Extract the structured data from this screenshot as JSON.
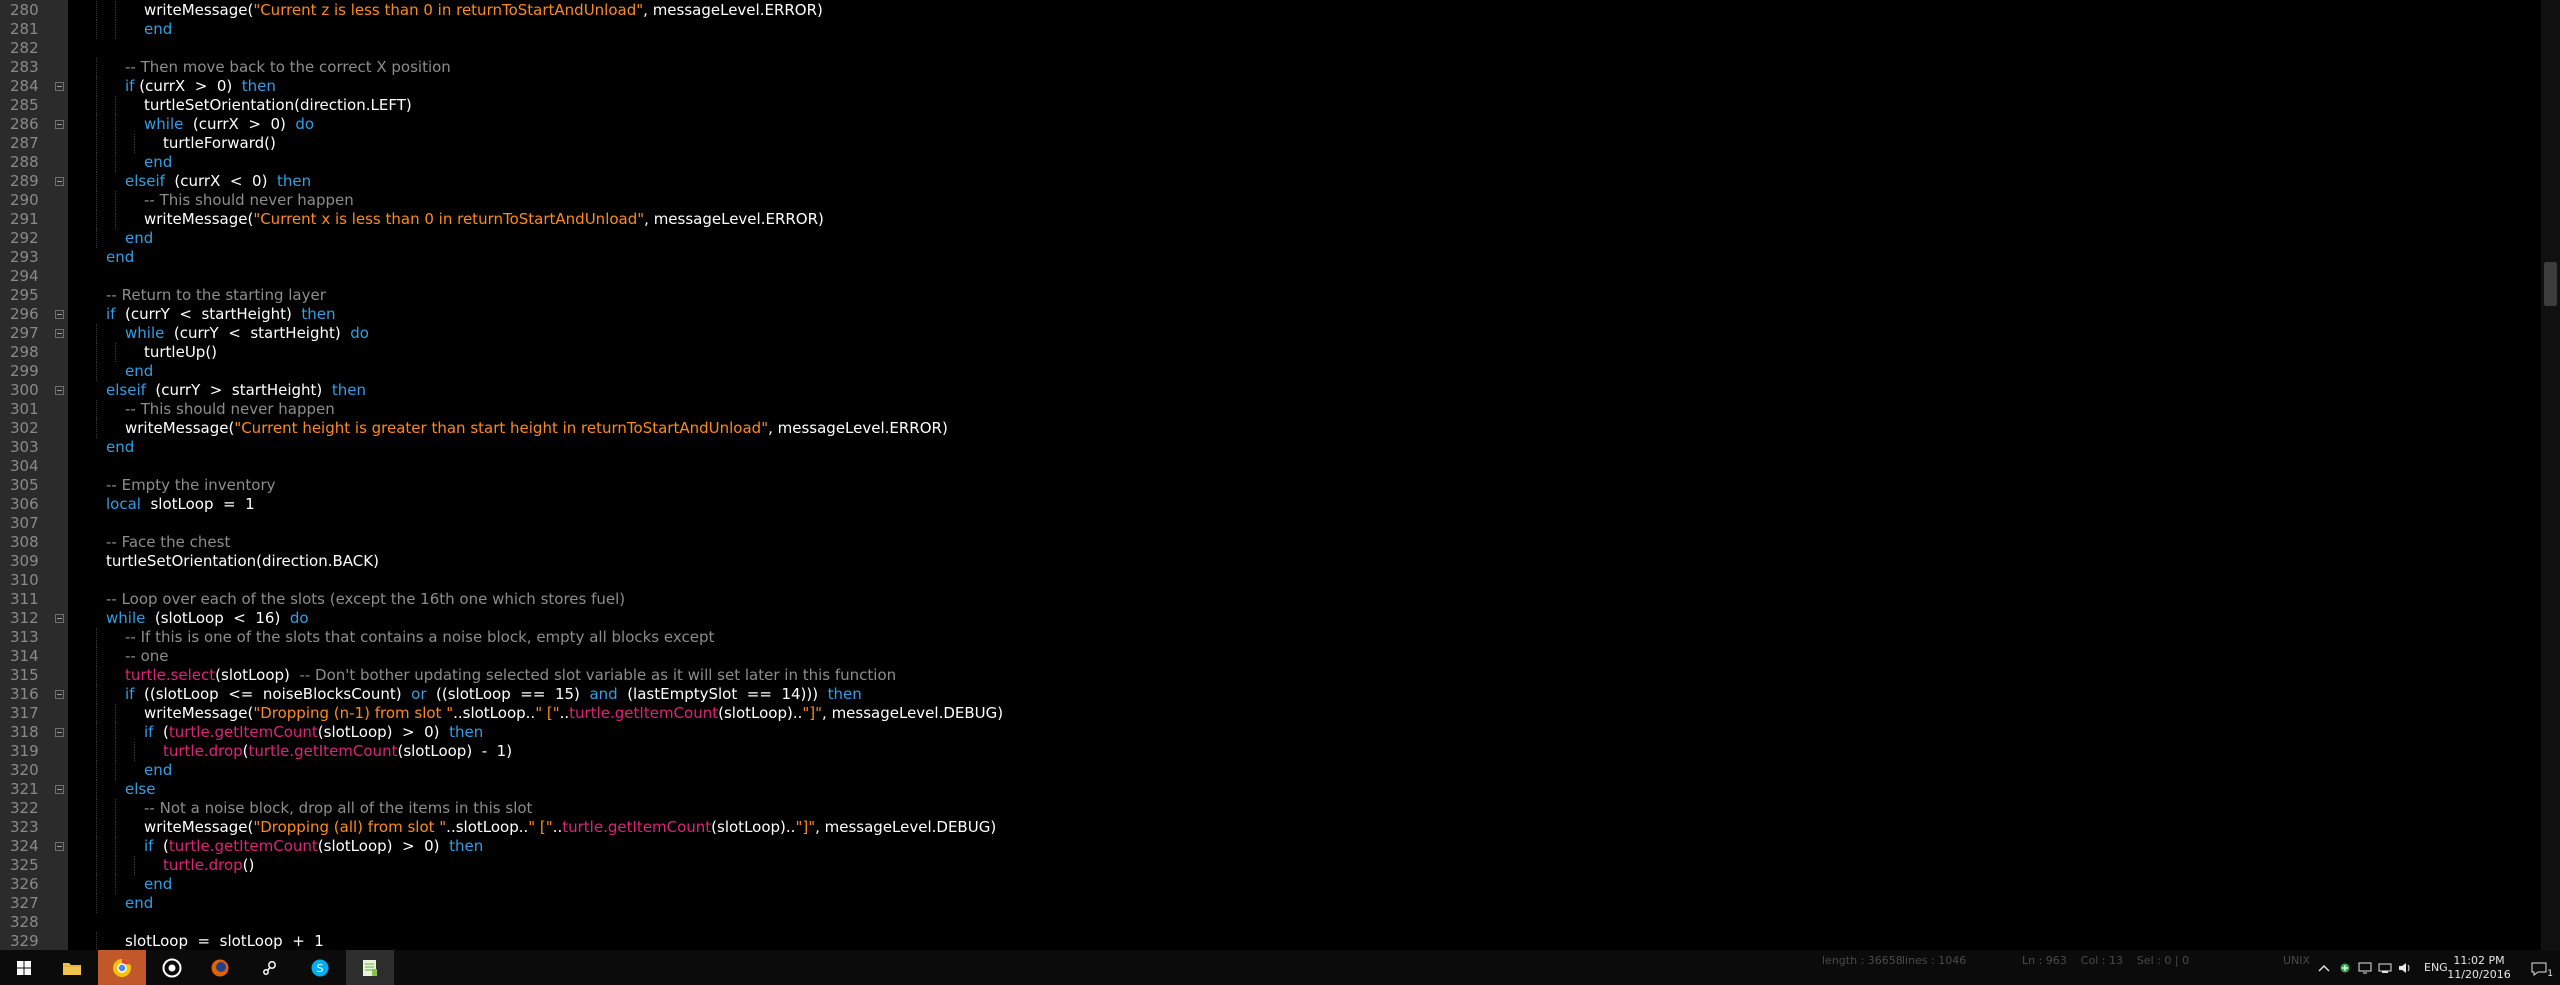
{
  "editor": {
    "lines": [
      {
        "num": 280,
        "indent": 2,
        "tokens": [
          [
            "id",
            "writeMessage("
          ],
          [
            "str",
            "\"Current z is less than 0 in returnToStartAndUnload\""
          ],
          [
            "id",
            ", messageLevel.ERROR)"
          ]
        ]
      },
      {
        "num": 281,
        "indent": 2,
        "tokens": [
          [
            "kw",
            "end"
          ]
        ]
      },
      {
        "num": 282,
        "indent": 0,
        "tokens": []
      },
      {
        "num": 283,
        "indent": 1,
        "tokens": [
          [
            "com",
            "-- Then move back to the correct X position"
          ]
        ]
      },
      {
        "num": 284,
        "indent": 1,
        "fold": true,
        "tokens": [
          [
            "kw",
            "if"
          ],
          [
            "id",
            " (currX  >  0)  "
          ],
          [
            "kw",
            "then"
          ]
        ]
      },
      {
        "num": 285,
        "indent": 2,
        "tokens": [
          [
            "id",
            "turtleSetOrientation(direction.LEFT)"
          ]
        ]
      },
      {
        "num": 286,
        "indent": 2,
        "fold": true,
        "tokens": [
          [
            "kw",
            "while"
          ],
          [
            "id",
            "  (currX  >  0)  "
          ],
          [
            "kw",
            "do"
          ]
        ]
      },
      {
        "num": 287,
        "indent": 3,
        "tokens": [
          [
            "id",
            "turtleForward()"
          ]
        ]
      },
      {
        "num": 288,
        "indent": 2,
        "tokens": [
          [
            "kw",
            "end"
          ]
        ]
      },
      {
        "num": 289,
        "indent": 1,
        "fold": true,
        "tokens": [
          [
            "kw",
            "elseif"
          ],
          [
            "id",
            "  (currX  <  0)  "
          ],
          [
            "kw",
            "then"
          ]
        ]
      },
      {
        "num": 290,
        "indent": 2,
        "tokens": [
          [
            "com",
            "-- This should never happen"
          ]
        ]
      },
      {
        "num": 291,
        "indent": 2,
        "tokens": [
          [
            "id",
            "writeMessage("
          ],
          [
            "str",
            "\"Current x is less than 0 in returnToStartAndUnload\""
          ],
          [
            "id",
            ", messageLevel.ERROR)"
          ]
        ]
      },
      {
        "num": 292,
        "indent": 1,
        "tokens": [
          [
            "kw",
            "end"
          ]
        ]
      },
      {
        "num": 293,
        "indent": 0,
        "tokens": [
          [
            "kw",
            "end"
          ]
        ]
      },
      {
        "num": 294,
        "indent": 0,
        "tokens": []
      },
      {
        "num": 295,
        "indent": 0,
        "tokens": [
          [
            "com",
            "-- Return to the starting layer"
          ]
        ]
      },
      {
        "num": 296,
        "indent": 0,
        "fold": true,
        "tokens": [
          [
            "kw",
            "if"
          ],
          [
            "id",
            "  (currY  <  startHeight)  "
          ],
          [
            "kw",
            "then"
          ]
        ]
      },
      {
        "num": 297,
        "indent": 1,
        "fold": true,
        "tokens": [
          [
            "kw",
            "while"
          ],
          [
            "id",
            "  (currY  <  startHeight)  "
          ],
          [
            "kw",
            "do"
          ]
        ]
      },
      {
        "num": 298,
        "indent": 2,
        "tokens": [
          [
            "id",
            "turtleUp()"
          ]
        ]
      },
      {
        "num": 299,
        "indent": 1,
        "tokens": [
          [
            "kw",
            "end"
          ]
        ]
      },
      {
        "num": 300,
        "indent": 0,
        "fold": true,
        "tokens": [
          [
            "kw",
            "elseif"
          ],
          [
            "id",
            "  (currY  >  startHeight)  "
          ],
          [
            "kw",
            "then"
          ]
        ]
      },
      {
        "num": 301,
        "indent": 1,
        "tokens": [
          [
            "com",
            "-- This should never happen"
          ]
        ]
      },
      {
        "num": 302,
        "indent": 1,
        "tokens": [
          [
            "id",
            "writeMessage("
          ],
          [
            "str",
            "\"Current height is greater than start height in returnToStartAndUnload\""
          ],
          [
            "id",
            ", messageLevel.ERROR)"
          ]
        ]
      },
      {
        "num": 303,
        "indent": 0,
        "tokens": [
          [
            "kw",
            "end"
          ]
        ]
      },
      {
        "num": 304,
        "indent": 0,
        "tokens": []
      },
      {
        "num": 305,
        "indent": 0,
        "tokens": [
          [
            "com",
            "-- Empty the inventory"
          ]
        ]
      },
      {
        "num": 306,
        "indent": 0,
        "tokens": [
          [
            "kw",
            "local"
          ],
          [
            "id",
            "  slotLoop  =  1"
          ]
        ]
      },
      {
        "num": 307,
        "indent": 0,
        "tokens": []
      },
      {
        "num": 308,
        "indent": 0,
        "tokens": [
          [
            "com",
            "-- Face the chest"
          ]
        ]
      },
      {
        "num": 309,
        "indent": 0,
        "tokens": [
          [
            "id",
            "turtleSetOrientation(direction.BACK)"
          ]
        ]
      },
      {
        "num": 310,
        "indent": 0,
        "tokens": []
      },
      {
        "num": 311,
        "indent": 0,
        "tokens": [
          [
            "com",
            "-- Loop over each of the slots (except the 16th one which stores fuel)"
          ]
        ]
      },
      {
        "num": 312,
        "indent": 0,
        "fold": true,
        "tokens": [
          [
            "kw",
            "while"
          ],
          [
            "id",
            "  (slotLoop  <  16)  "
          ],
          [
            "kw",
            "do"
          ]
        ]
      },
      {
        "num": 313,
        "indent": 1,
        "tokens": [
          [
            "com",
            "-- If this is one of the slots that contains a noise block, empty all blocks except"
          ]
        ]
      },
      {
        "num": 314,
        "indent": 1,
        "tokens": [
          [
            "com",
            "-- one"
          ]
        ]
      },
      {
        "num": 315,
        "indent": 1,
        "tokens": [
          [
            "api",
            "turtle.select"
          ],
          [
            "id",
            "(slotLoop)  "
          ],
          [
            "com",
            "-- Don't bother updating selected slot variable as it will set later in this function"
          ]
        ]
      },
      {
        "num": 316,
        "indent": 1,
        "fold": true,
        "tokens": [
          [
            "kw",
            "if"
          ],
          [
            "id",
            "  ((slotLoop  <=  noiseBlocksCount)  "
          ],
          [
            "kw",
            "or"
          ],
          [
            "id",
            "  ((slotLoop  ==  15)  "
          ],
          [
            "kw",
            "and"
          ],
          [
            "id",
            "  (lastEmptySlot  ==  14)))  "
          ],
          [
            "kw",
            "then"
          ]
        ]
      },
      {
        "num": 317,
        "indent": 2,
        "tokens": [
          [
            "id",
            "writeMessage("
          ],
          [
            "str",
            "\"Dropping (n-1) from slot \""
          ],
          [
            "id",
            "..slotLoop.."
          ],
          [
            "str",
            "\" [\""
          ],
          [
            "id",
            ".."
          ],
          [
            "api",
            "turtle.getItemCount"
          ],
          [
            "id",
            "(slotLoop).."
          ],
          [
            "str",
            "\"]\""
          ],
          [
            "id",
            ", messageLevel.DEBUG)"
          ]
        ]
      },
      {
        "num": 318,
        "indent": 2,
        "fold": true,
        "tokens": [
          [
            "kw",
            "if"
          ],
          [
            "id",
            "  ("
          ],
          [
            "api",
            "turtle.getItemCount"
          ],
          [
            "id",
            "(slotLoop)  >  0)  "
          ],
          [
            "kw",
            "then"
          ]
        ]
      },
      {
        "num": 319,
        "indent": 3,
        "tokens": [
          [
            "api",
            "turtle.drop"
          ],
          [
            "id",
            "("
          ],
          [
            "api",
            "turtle.getItemCount"
          ],
          [
            "id",
            "(slotLoop)  -  1)"
          ]
        ]
      },
      {
        "num": 320,
        "indent": 2,
        "tokens": [
          [
            "kw",
            "end"
          ]
        ]
      },
      {
        "num": 321,
        "indent": 1,
        "fold": true,
        "tokens": [
          [
            "kw",
            "else"
          ]
        ]
      },
      {
        "num": 322,
        "indent": 2,
        "tokens": [
          [
            "com",
            "-- Not a noise block, drop all of the items in this slot"
          ]
        ]
      },
      {
        "num": 323,
        "indent": 2,
        "tokens": [
          [
            "id",
            "writeMessage("
          ],
          [
            "str",
            "\"Dropping (all) from slot \""
          ],
          [
            "id",
            "..slotLoop.."
          ],
          [
            "str",
            "\" [\""
          ],
          [
            "id",
            ".."
          ],
          [
            "api",
            "turtle.getItemCount"
          ],
          [
            "id",
            "(slotLoop).."
          ],
          [
            "str",
            "\"]\""
          ],
          [
            "id",
            ", messageLevel.DEBUG)"
          ]
        ]
      },
      {
        "num": 324,
        "indent": 2,
        "fold": true,
        "tokens": [
          [
            "kw",
            "if"
          ],
          [
            "id",
            "  ("
          ],
          [
            "api",
            "turtle.getItemCount"
          ],
          [
            "id",
            "(slotLoop)  >  0)  "
          ],
          [
            "kw",
            "then"
          ]
        ]
      },
      {
        "num": 325,
        "indent": 3,
        "tokens": [
          [
            "api",
            "turtle.drop"
          ],
          [
            "id",
            "()"
          ]
        ]
      },
      {
        "num": 326,
        "indent": 2,
        "tokens": [
          [
            "kw",
            "end"
          ]
        ]
      },
      {
        "num": 327,
        "indent": 1,
        "tokens": [
          [
            "kw",
            "end"
          ]
        ]
      },
      {
        "num": 328,
        "indent": 0,
        "tokens": []
      },
      {
        "num": 329,
        "indent": 1,
        "tokens": [
          [
            "id",
            "slotLoop  =  slotLoop  +  1"
          ]
        ]
      }
    ]
  },
  "statusbar": {
    "length": "length : 36658",
    "lines": "lines : 1046",
    "position": "Ln : 963    Col : 13    Sel : 0 | 0",
    "encoding": "UNIX"
  },
  "taskbar": {
    "apps": [
      {
        "name": "start-button",
        "icon": "windows-logo-icon"
      },
      {
        "name": "file-explorer-button",
        "icon": "folder-icon"
      },
      {
        "name": "chrome-button",
        "icon": "chrome-icon",
        "highlight": true
      },
      {
        "name": "obs-button",
        "icon": "record-icon"
      },
      {
        "name": "firefox-button",
        "icon": "firefox-icon"
      },
      {
        "name": "steam-button",
        "icon": "steam-icon"
      },
      {
        "name": "skype-button",
        "icon": "skype-icon"
      },
      {
        "name": "notepadpp-button",
        "icon": "notepad-icon",
        "active": true
      }
    ],
    "language": "ENG",
    "time": "11:02 PM",
    "date": "11/20/2016",
    "notification_count": "1"
  },
  "colors": {
    "keyword": "#2f9fe6",
    "string": "#ff8a1c",
    "comment": "#8c8c8c",
    "api": "#e0217a",
    "identifier": "#ffffff",
    "background": "#000000"
  }
}
